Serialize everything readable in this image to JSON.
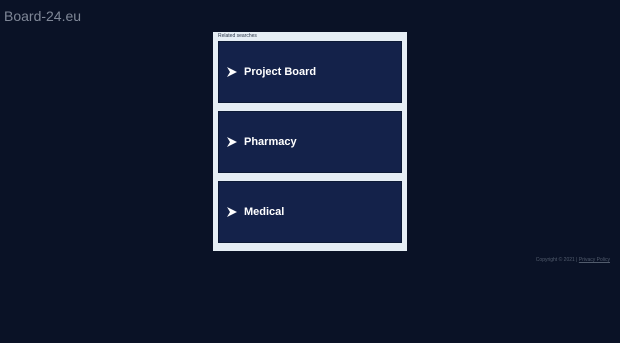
{
  "site": {
    "title": "Board-24.eu"
  },
  "panel": {
    "header": "Related searches",
    "items": [
      {
        "label": "Project Board"
      },
      {
        "label": "Pharmacy"
      },
      {
        "label": "Medical"
      }
    ],
    "icon": "arrow-right-icon"
  },
  "footer": {
    "copyright": "Copyright © 2021 |",
    "privacy_label": "Privacy Policy"
  },
  "colors": {
    "background": "#0a1226",
    "panel_bg": "#e6eef5",
    "item_bg": "#14224a",
    "text_primary": "#ffffff",
    "text_muted": "#7f8797"
  }
}
